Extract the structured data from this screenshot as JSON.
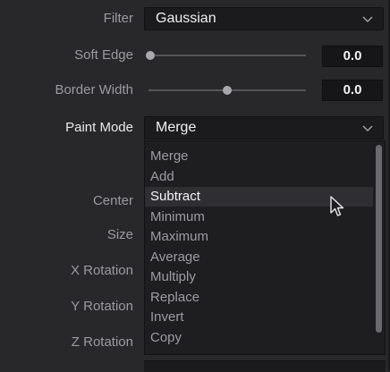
{
  "filter": {
    "label": "Filter",
    "value": "Gaussian",
    "icon": "chevron-down-icon"
  },
  "soft_edge": {
    "label": "Soft Edge",
    "value": "0.0",
    "level": 0.0
  },
  "border_width": {
    "label": "Border Width",
    "value": "0.0",
    "level": 0.5
  },
  "paint_mode": {
    "label": "Paint Mode",
    "value": "Merge",
    "icon": "chevron-down-icon"
  },
  "labels": {
    "center": "Center",
    "size": "Size",
    "x_rotation": "X Rotation",
    "y_rotation": "Y Rotation",
    "z_rotation": "Z Rotation"
  },
  "dropdown": {
    "items": [
      "Merge",
      "Add",
      "Subtract",
      "Minimum",
      "Maximum",
      "Average",
      "Multiply",
      "Replace",
      "Invert",
      "Copy"
    ],
    "hovered": "Subtract"
  },
  "colors": {
    "background": "#28282b",
    "field": "#1b1b1d",
    "hover": "#2f2f33"
  }
}
